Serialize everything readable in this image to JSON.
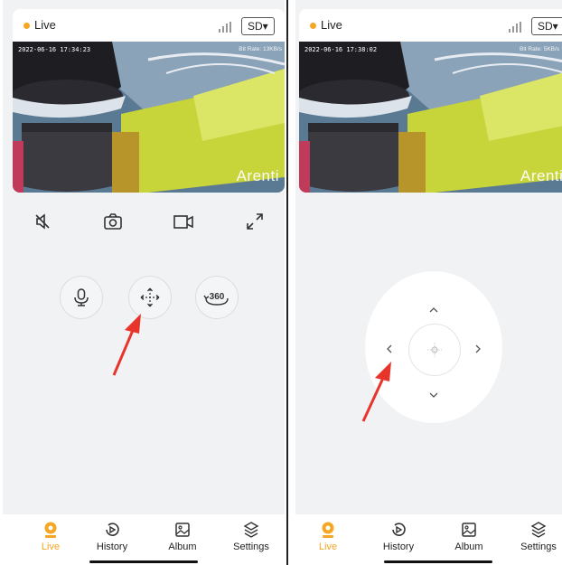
{
  "colors": {
    "accent": "#f5a623",
    "pointer_arrow": "#e8352b",
    "background": "#f1f2f4"
  },
  "left": {
    "status": "Live",
    "quality": "SD▾",
    "timestamp": "2022-06-16 17:34:23",
    "bitrate": "Bit Rate: 13KB/s",
    "brand": "Arenti",
    "controls": [
      "speaker-muted-icon",
      "camera-snapshot-icon",
      "video-record-icon",
      "fullscreen-icon"
    ],
    "actions": [
      "microphone-icon",
      "ptz-move-icon",
      "panorama-360-icon"
    ],
    "panorama_label": "360"
  },
  "right": {
    "status": "Live",
    "quality": "SD▾",
    "timestamp": "2022-06-16 17:38:02",
    "bitrate": "Bit Rate: 5KB/s",
    "brand": "Arenti",
    "ptz": [
      "up",
      "left",
      "right",
      "down"
    ]
  },
  "tabs": [
    {
      "label": "Live",
      "icon": "live-camera-icon",
      "active": true
    },
    {
      "label": "History",
      "icon": "history-icon",
      "active": false
    },
    {
      "label": "Album",
      "icon": "album-icon",
      "active": false
    },
    {
      "label": "Settings",
      "icon": "settings-icon",
      "active": false
    }
  ]
}
